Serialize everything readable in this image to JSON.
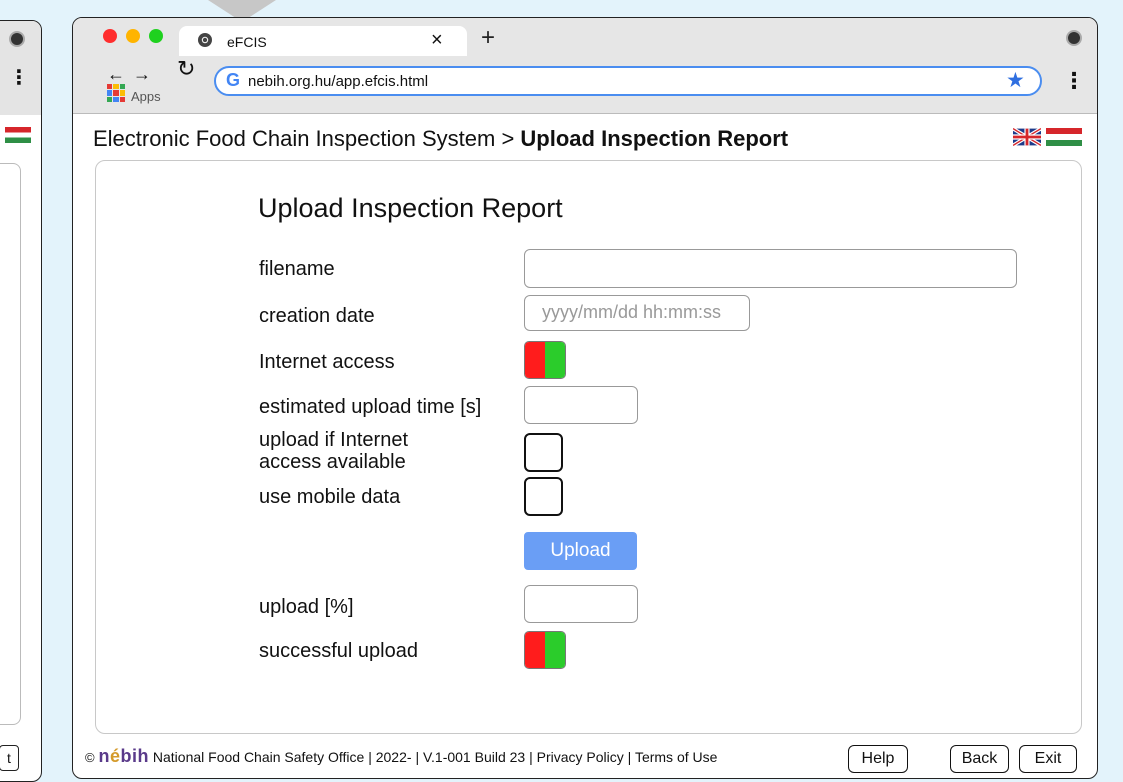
{
  "browser": {
    "tab_title": "eFCIS",
    "url": "nebih.org.hu/app.efcis.html",
    "apps_label": "Apps"
  },
  "page": {
    "breadcrumb_root": "Electronic Food Chain Inspection System",
    "breadcrumb_sep": ">",
    "breadcrumb_current": "Upload Inspection Report",
    "flags": [
      "uk-flag-icon",
      "hu-flag-icon"
    ]
  },
  "form": {
    "title": "Upload Inspection Report",
    "filename_label": "filename",
    "filename_value": "",
    "creation_date_label": "creation date",
    "creation_date_placeholder": "yyyy/mm/dd hh:mm:ss",
    "internet_access_label": "Internet access",
    "estimated_time_label": "estimated upload time [s]",
    "estimated_time_value": "",
    "upload_if_available_label_1": "upload if Internet",
    "upload_if_available_label_2": "access available",
    "mobile_data_label": "use mobile data",
    "upload_button": "Upload",
    "upload_pct_label": "upload [%]",
    "upload_pct_value": "",
    "success_label": "successful upload"
  },
  "footer": {
    "copyright": "©",
    "logo_a": "n",
    "logo_b": "é",
    "logo_c": "bih",
    "org": "National Food Chain Safety Office",
    "year": "2022-",
    "version": "V.1-001 Build 23",
    "privacy": "Privacy Policy",
    "terms": "Terms of Use",
    "sep": "|",
    "help_button": "Help",
    "back_button": "Back",
    "exit_button": "Exit"
  },
  "background_window": {
    "exit_fragment": "t"
  },
  "colors": {
    "accent_blue": "#4a8df0",
    "upload_button": "#6a9ef5",
    "indicator_red": "#ff1c1c",
    "indicator_green": "#2bcc2b"
  }
}
